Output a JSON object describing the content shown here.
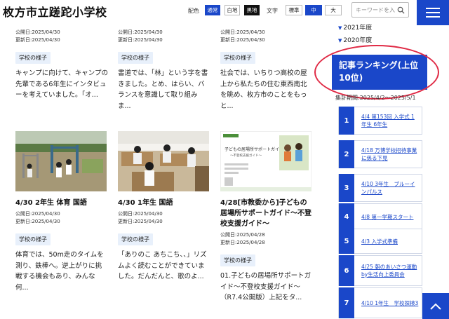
{
  "header": {
    "title": "枚方市立蹉跎小学校",
    "color_label": "配色",
    "color_options": [
      "通常",
      "白地",
      "黒地"
    ],
    "text_label": "文字",
    "text_options": [
      "標準",
      "中",
      "大"
    ],
    "search_placeholder": "キーワードを入"
  },
  "top_row": [
    {
      "published": "公開日:2025/04/30",
      "updated": "更新日:2025/04/30",
      "tag": "学校の様子",
      "excerpt": "キャンプに向けて、キャンプの先輩である6年生にインタビューを考えていました。「オ..."
    },
    {
      "published": "公開日:2025/04/30",
      "updated": "更新日:2025/04/30",
      "tag": "学校の様子",
      "excerpt": "書道では、「林」という字を書きました。とめ、はらい、バランスを意識して取り組みま..."
    },
    {
      "published": "公開日:2025/04/30",
      "updated": "更新日:2025/04/30",
      "tag": "学校の様子",
      "excerpt": "社会では、いちりつ高校の屋上から私たちの住む東西南北を眺め、枚方市のことをもっと..."
    }
  ],
  "bottom_row": [
    {
      "title": "4/30 2年生 体育 国語",
      "published": "公開日:2025/04/30",
      "updated": "更新日:2025/04/30",
      "tag": "学校の様子",
      "excerpt": "体育では、50m走のタイムを測り、鉄棒へ。逆上がりに挑戦する機会もあり、みんな何..."
    },
    {
      "title": "4/30 1年生 国語",
      "published": "公開日:2025/04/30",
      "updated": "更新日:2025/04/30",
      "tag": "学校の様子",
      "excerpt": "「ありのこ あちこち、、」リズムよく読むことができていました。だんだんと、歌のよ..."
    },
    {
      "title": "4/28[市教委から]子どもの居場所サポートガイド〜不登校支援ガイド〜",
      "published": "公開日:2025/04/28",
      "updated": "更新日:2025/04/28",
      "tag": "学校の様子",
      "excerpt": "01.子どもの居場所サポートガイド〜不登校支援ガイド〜（R7.4公開版）上記をタ...",
      "thumb_heading": "子どもの居場所サポートガイド",
      "thumb_sub": "〜不登校支援ガイド〜"
    }
  ],
  "sidebar": {
    "years": [
      "2021年度",
      "2020年度"
    ],
    "ranking_title": "記事ランキング(上位10位)",
    "period": "集計期間:2025/4/2〜2025/5/1",
    "ranking": [
      {
        "rank": "1",
        "text": "4/4 第153回 入学式 1年生 6年生"
      },
      {
        "rank": "2",
        "text": "4/18 万博学校招待事業に係る下見"
      },
      {
        "rank": "3",
        "text": "4/10 3年生　ブルーインパルス"
      },
      {
        "rank": "4",
        "text": "4/8 第一学期スタート"
      },
      {
        "rank": "5",
        "text": "4/3 入学式準備"
      },
      {
        "rank": "6",
        "text": "4/25 朝のあいさつ運動by生活向上委員会"
      },
      {
        "rank": "7",
        "text": "4/10 1年生　学校探検3"
      }
    ]
  },
  "colors": {
    "accent": "#1a47c9",
    "highlight_circle": "#e02a45",
    "tag_bg": "#e8f0fb"
  },
  "icons": {
    "search": "search-icon",
    "menu": "hamburger-icon",
    "to_top": "chevron-up-icon"
  }
}
